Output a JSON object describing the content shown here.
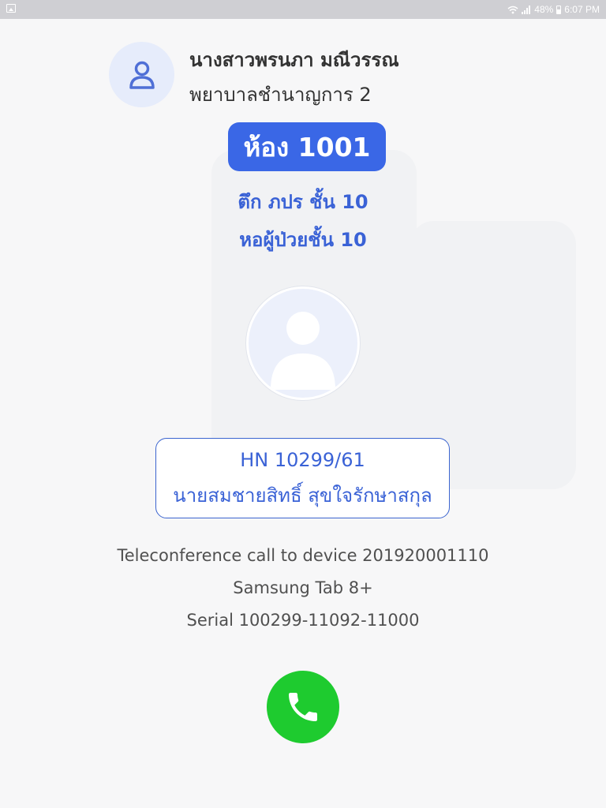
{
  "status_bar": {
    "battery": "48%",
    "time": "6:07 PM"
  },
  "nurse": {
    "name": "นางสาวพรนภา มณีวรรณ",
    "title": "พยาบาลชำนาญการ 2",
    "icon": "user-outline-icon"
  },
  "room": {
    "label": "ห้อง 1001",
    "building": "ตึก ภปร ชั้น 10",
    "ward": "หอผู้ป่วยชั้น 10"
  },
  "patient": {
    "avatar_icon": "user-silhouette-icon",
    "hn": "HN 10299/61",
    "name": "นายสมชายสิทธิ์ สุขใจรักษาสกุล"
  },
  "call_info": {
    "line1": "Teleconference call to device 201920001110",
    "line2": "Samsung Tab 8+",
    "line3": "Serial 100299-11092-11000"
  },
  "call_button": {
    "icon": "phone-icon",
    "color": "#1ecb2f"
  },
  "colors": {
    "accent": "#3a67e6",
    "text_blue": "#3a62d6"
  }
}
